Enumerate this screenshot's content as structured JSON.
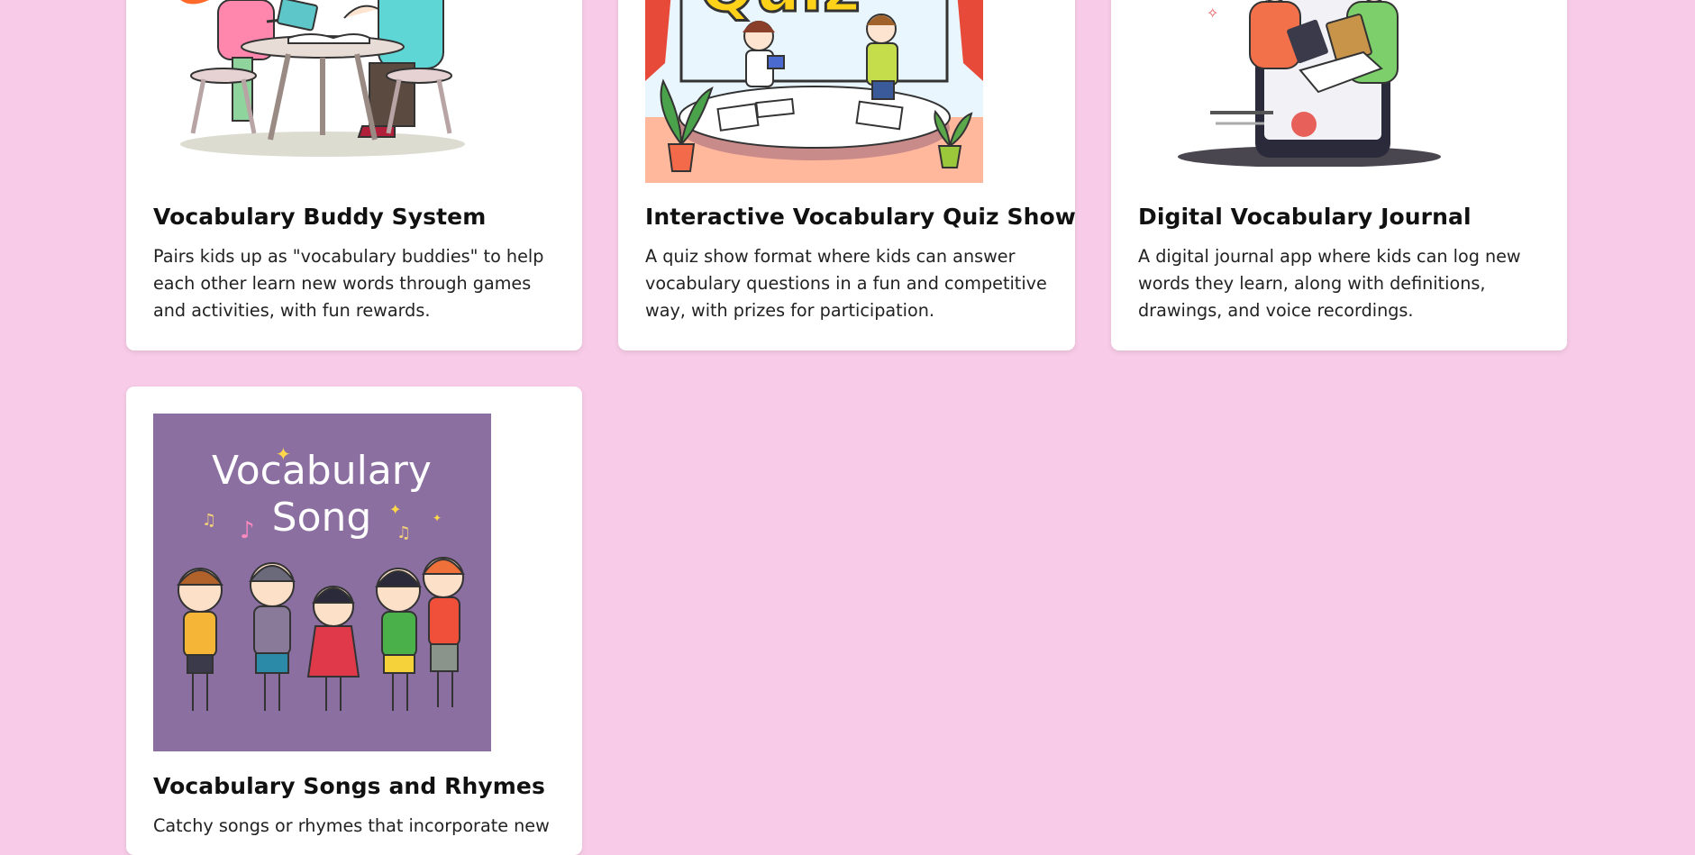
{
  "cards": [
    {
      "title": "Vocabulary Buddy System",
      "description": "Pairs kids up as \"vocabulary buddies\" to help each other learn new words through games and activities, with fun rewards.",
      "image_icon": "two-kids-at-table-illustration"
    },
    {
      "title": "Interactive Vocabulary Quiz Show",
      "description": "A quiz show format where kids can answer vocabulary questions in a fun and competitive way, with prizes for participation.",
      "image_icon": "quiz-show-stage-illustration",
      "image_text": "Quiz"
    },
    {
      "title": "Digital Vocabulary Journal",
      "description": "A digital journal app where kids can log new words they learn, along with definitions, drawings, and voice recordings.",
      "image_icon": "kids-with-phone-journal-illustration"
    },
    {
      "title": "Vocabulary Songs and Rhymes",
      "description": "Catchy songs or rhymes that incorporate new",
      "image_icon": "kids-singing-illustration",
      "image_text_line1": "Vocabulary",
      "image_text_line2": "Song"
    }
  ],
  "colors": {
    "page_background": "#f8cce8",
    "card_background": "#ffffff",
    "song_poster_purple": "#8b6fa0"
  }
}
